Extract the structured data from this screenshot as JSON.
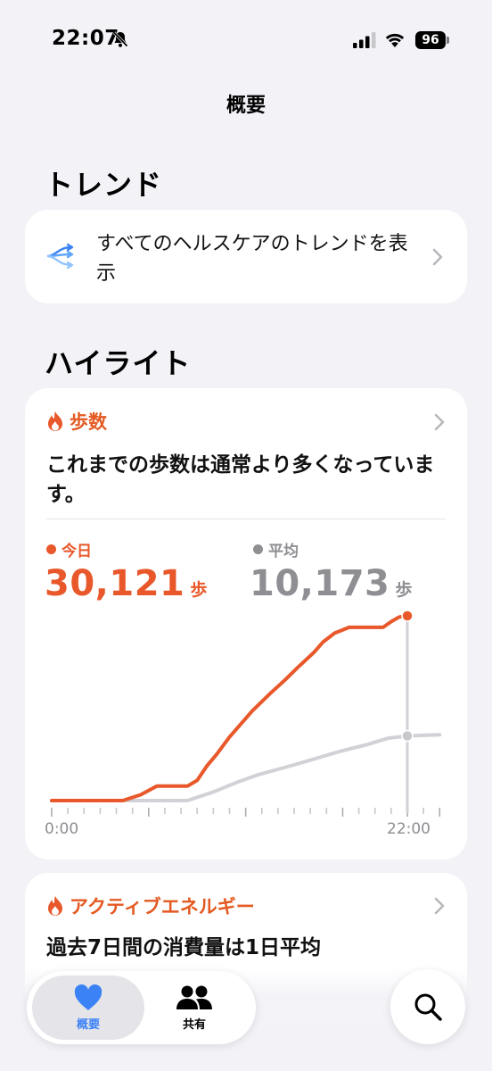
{
  "status_bar": {
    "time": "22:07",
    "battery": "96"
  },
  "nav": {
    "title": "概要"
  },
  "sections": {
    "trends": "トレンド",
    "highlights": "ハイライト"
  },
  "trend_card": {
    "text": "すべてのヘルスケアのトレンドを表示"
  },
  "steps_card": {
    "title": "歩数",
    "description": "これまでの歩数は通常より多くなっています。",
    "today_label": "今日",
    "today_value": "30,121",
    "average_label": "平均",
    "average_value": "10,173",
    "unit": "歩",
    "x_start_label": "0:00",
    "x_end_label": "22:00",
    "colors": {
      "today": "#e8582a",
      "average": "#9a9aa0"
    }
  },
  "chart_data": {
    "type": "line",
    "x_axis": "hour",
    "xlim": [
      0,
      24
    ],
    "ylim": [
      0,
      32000
    ],
    "tick_labels": [
      "0:00",
      "22:00"
    ],
    "series": [
      {
        "name": "今日",
        "color": "#e8582a",
        "x": [
          0,
          4.4,
          5.5,
          6.5,
          8.4,
          9.0,
          9.6,
          10.2,
          11.0,
          12.4,
          13.5,
          14.4,
          15.2,
          16.2,
          16.8,
          17.5,
          18.4,
          19.1,
          20.5,
          21.0,
          21.5,
          22.0
        ],
        "y": [
          0,
          0,
          1000,
          2500,
          2500,
          3500,
          6000,
          8000,
          11000,
          15500,
          18500,
          20800,
          23000,
          25600,
          27500,
          29000,
          30000,
          30000,
          30000,
          31000,
          31800,
          32000
        ]
      },
      {
        "name": "平均",
        "color": "#c7c7cc",
        "x": [
          0,
          8.4,
          10,
          11.5,
          12.8,
          14.5,
          16,
          17.8,
          19.5,
          20.8,
          22.0,
          23.0,
          24.0
        ],
        "y": [
          0,
          0,
          1500,
          3200,
          4500,
          5800,
          7000,
          8500,
          9700,
          10800,
          11200,
          11300,
          11400
        ]
      }
    ]
  },
  "energy_card": {
    "title": "アクティブエネルギー",
    "description": "過去7日間の消費量は1日平均"
  },
  "tabbar": {
    "summary": "概要",
    "sharing": "共有"
  }
}
